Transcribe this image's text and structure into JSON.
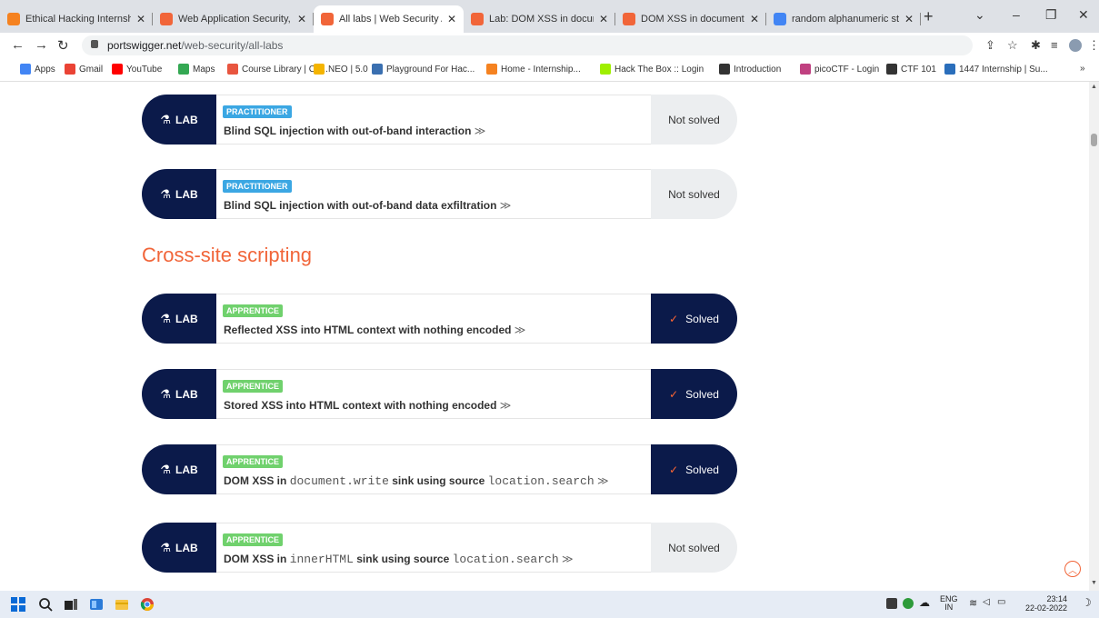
{
  "browser": {
    "tabs": [
      {
        "title": "Ethical Hacking Internship",
        "fav": "#f58220",
        "active": false
      },
      {
        "title": "Web Application Security, T",
        "fav": "#f16539",
        "active": false
      },
      {
        "title": "All labs | Web Security Acad",
        "fav": "#f16539",
        "active": true
      },
      {
        "title": "Lab: DOM XSS in document",
        "fav": "#f16539",
        "active": false
      },
      {
        "title": "DOM XSS in document.writ",
        "fav": "#f16539",
        "active": false
      },
      {
        "title": "random alphanumeric strin",
        "fav": "#4285f4",
        "active": false
      }
    ],
    "url_host": "portswigger.net",
    "url_path": "/web-security/all-labs",
    "bookmarks": [
      {
        "label": "Apps",
        "color": "#4285f4"
      },
      {
        "label": "Gmail",
        "color": "#ea4335"
      },
      {
        "label": "YouTube",
        "color": "#ff0000"
      },
      {
        "label": "Maps",
        "color": "#34a853"
      },
      {
        "label": "Course Library | Co...",
        "color": "#e8553f"
      },
      {
        "label": "NEO | 5.0",
        "color": "#f4b400"
      },
      {
        "label": "Playground For Hac...",
        "color": "#3a6fb0"
      },
      {
        "label": "Home - Internship...",
        "color": "#f58220"
      },
      {
        "label": "Hack The Box :: Login",
        "color": "#9fef00"
      },
      {
        "label": "Introduction",
        "color": "#333333"
      },
      {
        "label": "picoCTF - Login",
        "color": "#c04080"
      },
      {
        "label": "CTF 101",
        "color": "#333333"
      },
      {
        "label": "1447 Internship | Su...",
        "color": "#2a6ebb"
      }
    ]
  },
  "page": {
    "section_heading": "Cross-site scripting",
    "lab_label": "LAB",
    "labs": [
      {
        "level": "PRACTITIONER",
        "title_parts": [
          {
            "t": "Blind SQL injection with out-of-band interaction",
            "code": false
          }
        ],
        "status": "Not solved",
        "solved": false
      },
      {
        "level": "PRACTITIONER",
        "title_parts": [
          {
            "t": "Blind SQL injection with out-of-band data exfiltration",
            "code": false
          }
        ],
        "status": "Not solved",
        "solved": false
      },
      {
        "level": "APPRENTICE",
        "title_parts": [
          {
            "t": "Reflected XSS into HTML context with nothing encoded",
            "code": false
          }
        ],
        "status": "Solved",
        "solved": true
      },
      {
        "level": "APPRENTICE",
        "title_parts": [
          {
            "t": "Stored XSS into HTML context with nothing encoded",
            "code": false
          }
        ],
        "status": "Solved",
        "solved": true
      },
      {
        "level": "APPRENTICE",
        "title_parts": [
          {
            "t": "DOM XSS in ",
            "code": false
          },
          {
            "t": "document.write",
            "code": true
          },
          {
            "t": " sink using source ",
            "code": false
          },
          {
            "t": "location.search",
            "code": true
          }
        ],
        "status": "Solved",
        "solved": true
      },
      {
        "level": "APPRENTICE",
        "title_parts": [
          {
            "t": "DOM XSS in ",
            "code": false
          },
          {
            "t": "innerHTML",
            "code": true
          },
          {
            "t": " sink using source ",
            "code": false
          },
          {
            "t": "location.search",
            "code": true
          }
        ],
        "status": "Not solved",
        "solved": false
      }
    ]
  },
  "taskbar": {
    "lang": "ENG",
    "region": "IN",
    "time": "23:14",
    "date": "22-02-2022"
  }
}
